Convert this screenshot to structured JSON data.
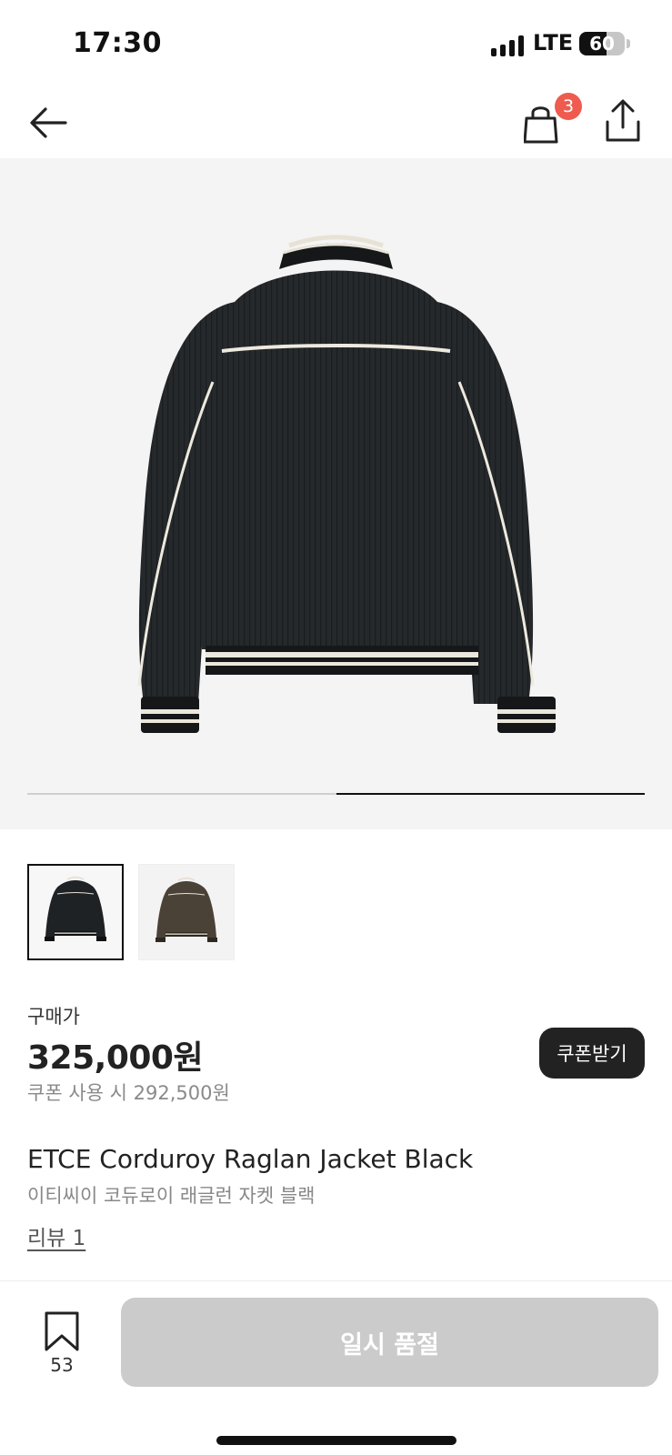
{
  "status_bar": {
    "time": "17:30",
    "network": "LTE",
    "battery": "60",
    "battery_level": 0.6
  },
  "header": {
    "back_icon": "arrow-left-icon",
    "cart_icon": "shopping-bag-icon",
    "cart_count": "3",
    "share_icon": "share-icon"
  },
  "gallery": {
    "current_index": 2,
    "total": 2,
    "progress": 0.5
  },
  "thumbnails": [
    {
      "name": "Black",
      "selected": true
    },
    {
      "name": "Brown",
      "selected": false
    }
  ],
  "price": {
    "label": "구매가",
    "amount": "325,000원",
    "coupon_price": "쿠폰 사용 시 292,500원",
    "coupon_button": "쿠폰받기"
  },
  "product": {
    "name_en": "ETCE Corduroy Raglan Jacket Black",
    "name_ko": "이티씨이 코듀로이 래글런 자켓 블랙",
    "review_link": "리뷰 1"
  },
  "bottom_bar": {
    "bookmark_icon": "bookmark-icon",
    "bookmark_count": "53",
    "action_label": "일시 품절"
  },
  "colors": {
    "accent_badge": "#ef5b4f",
    "button_dark": "#222222",
    "soldout_bg": "#cbcbcb",
    "hero_bg": "#f4f4f4"
  }
}
